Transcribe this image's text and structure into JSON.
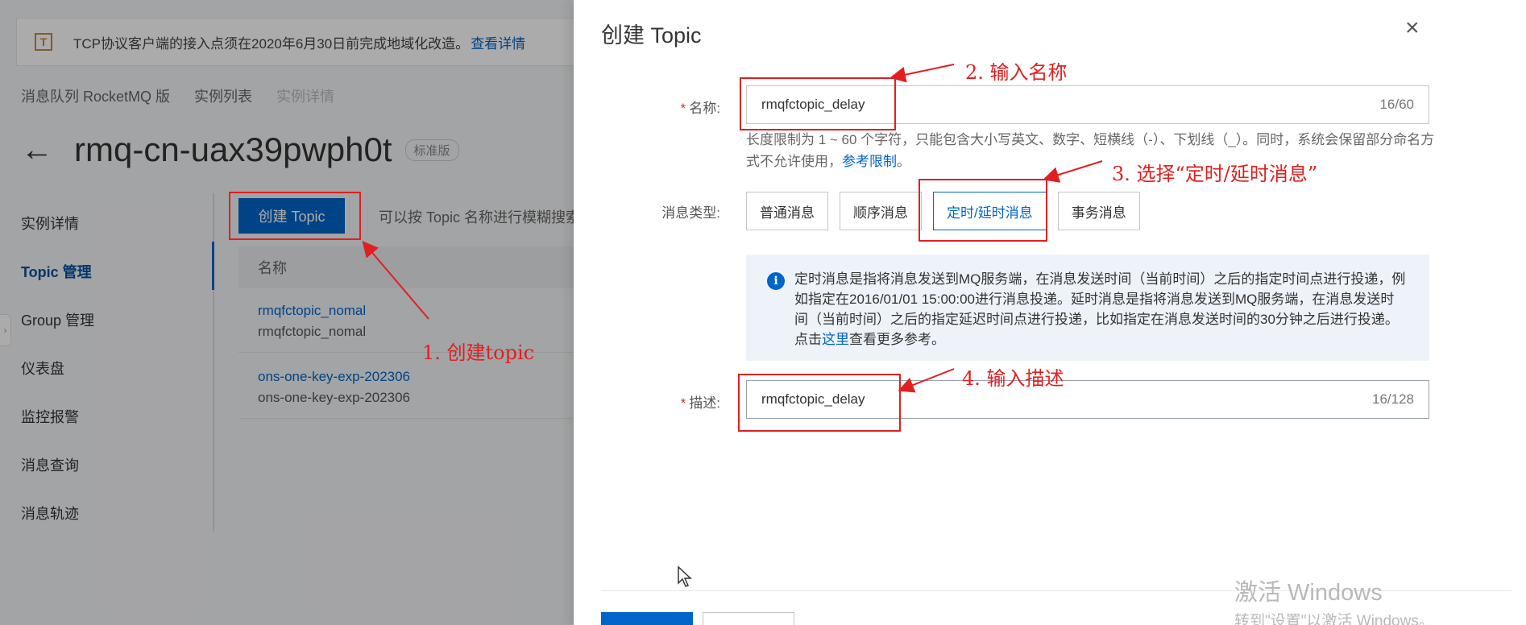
{
  "background_page": {
    "notice": {
      "text": "TCP协议客户端的接入点须在2020年6月30日前完成地域化改造。",
      "link": "查看详情",
      "icon": "notice-icon"
    },
    "breadcrumb": [
      "消息队列 RocketMQ 版",
      "实例列表",
      "实例详情"
    ],
    "back_icon": "←",
    "instance_name": "rmq-cn-uax39pwph0t",
    "instance_badge": "标准版",
    "side_nav": [
      "实例详情",
      "Topic 管理",
      "Group 管理",
      "仪表盘",
      "监控报警",
      "消息查询",
      "消息轨迹"
    ],
    "active_nav": "Topic 管理",
    "create_button": "创建 Topic",
    "search_hint": "可以按 Topic 名称进行模糊搜索",
    "table_header": "名称",
    "rows": [
      {
        "name": "rmqfctopic_nomal",
        "desc": "rmqfctopic_nomal"
      },
      {
        "name": "ons-one-key-exp-202306",
        "desc": "ons-one-key-exp-202306"
      }
    ]
  },
  "drawer": {
    "title": "创建 Topic",
    "close_icon": "×",
    "name_field": {
      "label": "名称:",
      "value": "rmqfctopic_delay",
      "counter": "16/60"
    },
    "help_text": "长度限制为 1 ~ 60 个字符，只能包含大小写英文、数字、短横线（-）、下划线（_）。同时，系统会保留部分命名方式不允许使用，",
    "help_link": "参考限制",
    "help_tail": "。",
    "type_label": "消息类型:",
    "message_types": [
      "普通消息",
      "顺序消息",
      "定时/延时消息",
      "事务消息"
    ],
    "selected_type": "定时/延时消息",
    "info_icon": "i",
    "info_text": "定时消息是指将消息发送到MQ服务端，在消息发送时间（当前时间）之后的指定时间点进行投递，例如指定在2016/01/01 15:00:00进行消息投递。延时消息是指将消息发送到MQ服务端，在消息发送时间（当前时间）之后的指定延迟时间点进行投递，比如指定在消息发送时间的30分钟之后进行投递。点击",
    "info_link": "这里",
    "info_tail": "查看更多参考。",
    "desc_field": {
      "label": "描述:",
      "value": "rmqfctopic_delay",
      "counter": "16/128"
    },
    "required_mark": "*"
  },
  "watermark": {
    "line1": "激活 Windows",
    "line2": "转到\"设置\"以激活 Windows。"
  },
  "annotations": {
    "step1": "1. 创建topic",
    "step2": "2. 输入名称",
    "step3": "3. 选择“定时/延时消息”",
    "step4": "4. 输入描述"
  },
  "colors": {
    "accent": "#0064c8",
    "annotation": "#e02020",
    "required": "#d93026"
  }
}
